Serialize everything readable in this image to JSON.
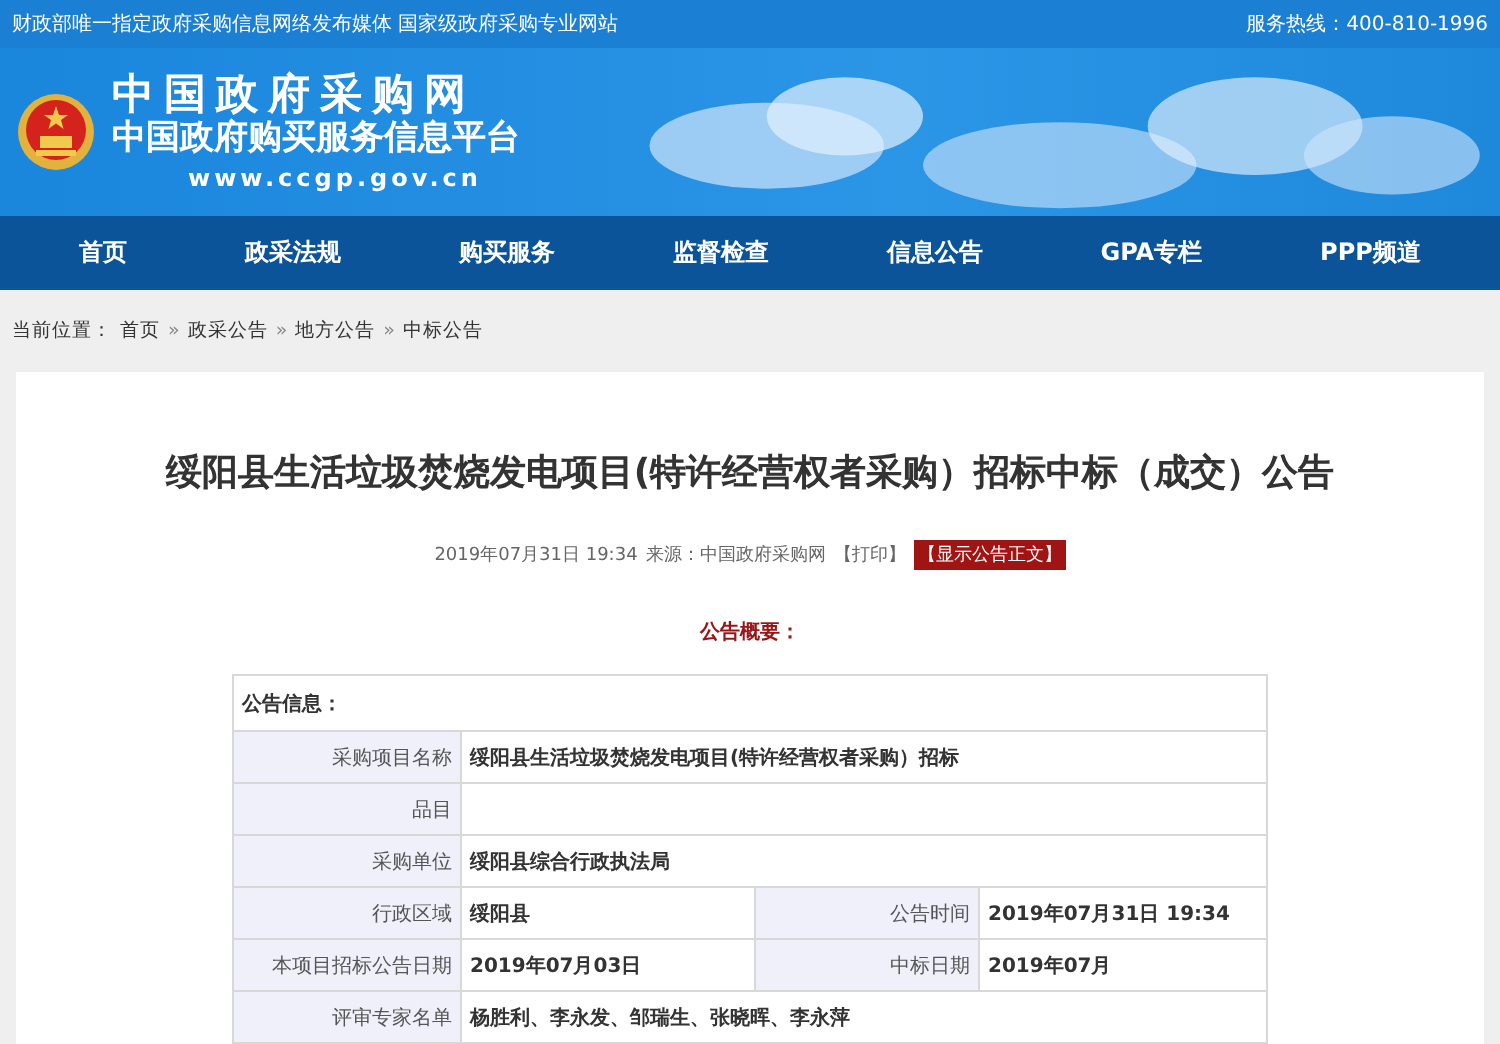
{
  "top_bar": {
    "tagline": "财政部唯一指定政府采购信息网络发布媒体 国家级政府采购专业网站",
    "hotline": "服务热线：400-810-1996"
  },
  "header": {
    "logo_title": "中国政府采购网",
    "logo_subtitle": "中国政府购买服务信息平台",
    "url": "www.ccgp.gov.cn"
  },
  "nav": [
    "首页",
    "政采法规",
    "购买服务",
    "监督检查",
    "信息公告",
    "GPA专栏",
    "PPP频道"
  ],
  "breadcrumb": {
    "prefix": "当前位置：",
    "separator": "»",
    "items": [
      "首页",
      "政采公告",
      "地方公告",
      "中标公告"
    ]
  },
  "article": {
    "title": "绥阳县生活垃圾焚烧发电项目(特许经营权者采购）招标中标（成交）公告",
    "date": "2019年07月31日 19:34",
    "source": "来源：中国政府采购网",
    "print_link": "【打印】",
    "show_body_button": "【显示公告正文】",
    "summary_heading": "公告概要："
  },
  "table": {
    "heading": "公告信息：",
    "rows": [
      {
        "kind": "full",
        "label": "采购项目名称",
        "value": "绥阳县生活垃圾焚烧发电项目(特许经营权者采购）招标"
      },
      {
        "kind": "full",
        "label": "品目"
      },
      {
        "kind": "full",
        "label": "采购单位",
        "value": "绥阳县综合行政执法局"
      },
      {
        "kind": "split",
        "label": "行政区域",
        "value": "绥阳县",
        "label2": "公告时间",
        "value2": "2019年07月31日 19:34"
      },
      {
        "kind": "split",
        "label": "本项目招标公告日期",
        "value": "2019年07月03日",
        "label2": "中标日期",
        "value2": "2019年07月"
      },
      {
        "kind": "full",
        "label": "评审专家名单",
        "value": "杨胜利、李永发、邹瑞生、张晓晖、李永萍"
      }
    ]
  }
}
